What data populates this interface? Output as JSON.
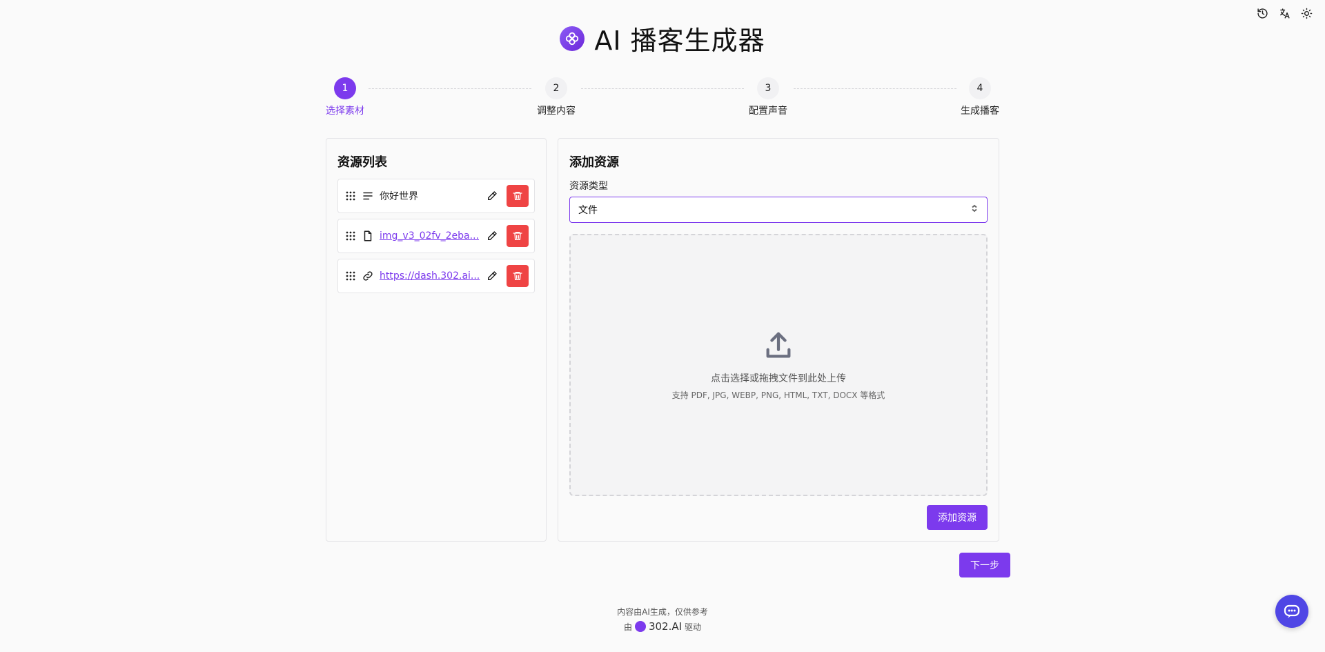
{
  "app": {
    "title": "AI 播客生成器"
  },
  "toolbar": {
    "icons": [
      "history-icon",
      "translate-icon",
      "sun-icon"
    ]
  },
  "stepper": {
    "current": 1,
    "steps": [
      {
        "number": "1",
        "label": "选择素材"
      },
      {
        "number": "2",
        "label": "调整内容"
      },
      {
        "number": "3",
        "label": "配置声音"
      },
      {
        "number": "4",
        "label": "生成播客"
      }
    ]
  },
  "resources": {
    "title": "资源列表",
    "items": [
      {
        "type": "text",
        "icon": "text-lines-icon",
        "label": "你好世界"
      },
      {
        "type": "file",
        "icon": "file-icon",
        "label": "img_v3_02fv_2eba..."
      },
      {
        "type": "link",
        "icon": "link-icon",
        "label": "https://dash.302.ai..."
      }
    ]
  },
  "add_resource": {
    "title": "添加资源",
    "type_label": "资源类型",
    "type_value": "文件",
    "dropzone_main": "点击选择或拖拽文件到此处上传",
    "dropzone_sub": "支持 PDF, JPG, WEBP, PNG, HTML, TXT, DOCX 等格式",
    "submit_label": "添加资源"
  },
  "next_label": "下一步",
  "footer": {
    "line1": "内容由AI生成，仅供参考",
    "by": "由",
    "brand": "302.AI",
    "powered": "驱动"
  },
  "colors": {
    "accent": "#7c3aed",
    "danger": "#ef4444",
    "chat": "#4f46e5"
  }
}
